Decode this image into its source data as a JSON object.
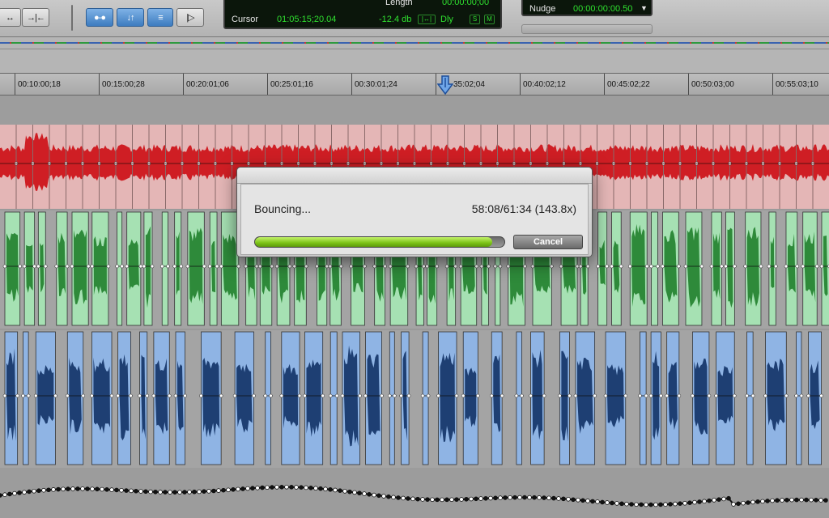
{
  "toolbar": {
    "btn1": "↔",
    "btn2": "→|←",
    "btn3": "●-●",
    "btn4": "↓↑",
    "btn5": "≡",
    "btn6": "|▷"
  },
  "counter": {
    "length_label": "Length",
    "length_value": "00:00:00;00",
    "cursor_label": "Cursor",
    "cursor_value": "01:05:15;20.04",
    "level_value": "-12.4 db",
    "dly_label": "Dly",
    "s_label": "S",
    "m_label": "M"
  },
  "nudge": {
    "label": "Nudge",
    "value": "00:00:00:00.50"
  },
  "ruler": {
    "labels": [
      "00:10:00;18",
      "00:15:00;28",
      "00:20:01;06",
      "00:25:01;16",
      "00:30:01;24",
      "35:02;04",
      "00:40:02;12",
      "00:45:02;22",
      "00:50:03;00",
      "00:55:03;10"
    ]
  },
  "dialog": {
    "title": "Bouncing...",
    "status": "58:08/61:34 (143.8x)",
    "progress": 0.95,
    "cancel_label": "Cancel"
  },
  "colors": {
    "red_wave": "#cf1e24",
    "red_bg": "#e4b6b6",
    "green_wave": "#2e8a3a",
    "green_bg": "#a6e1b3",
    "blue_wave": "#1e3f73",
    "blue_bg": "#8fb4e4",
    "progress_fill": "#7bc216"
  }
}
